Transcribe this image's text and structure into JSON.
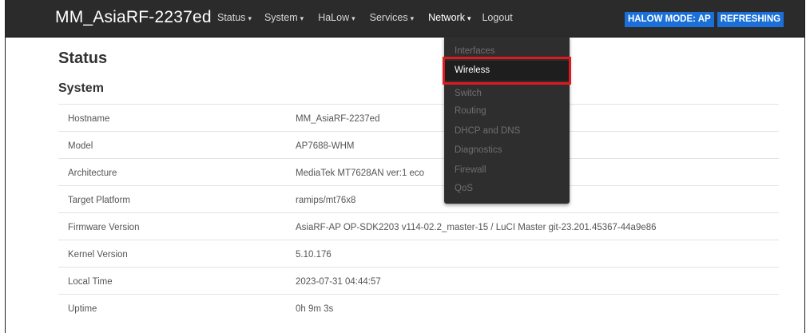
{
  "navbar": {
    "brand": "MM_AsiaRF-2237ed",
    "menu": [
      {
        "label": "Status"
      },
      {
        "label": "System"
      },
      {
        "label": "HaLow"
      },
      {
        "label": "Services"
      },
      {
        "label": "Network"
      },
      {
        "label": "Logout"
      }
    ],
    "caret": "▾",
    "badges": [
      "HALOW MODE: AP",
      "REFRESHING"
    ],
    "badge_color": "#1a6fd8"
  },
  "page": {
    "title": "Status",
    "section": "System"
  },
  "system_table": [
    {
      "label": "Hostname",
      "value": "MM_AsiaRF-2237ed"
    },
    {
      "label": "Model",
      "value": "AP7688-WHM"
    },
    {
      "label": "Architecture",
      "value": "MediaTek MT7628AN ver:1 eco"
    },
    {
      "label": "Target Platform",
      "value": "ramips/mt76x8"
    },
    {
      "label": "Firmware Version",
      "value": "AsiaRF-AP OP-SDK2203 v114-02.2_master-15 / LuCI Master git-23.201.45367-44a9e86"
    },
    {
      "label": "Kernel Version",
      "value": "5.10.176"
    },
    {
      "label": "Local Time",
      "value": "2023-07-31 04:44:57"
    },
    {
      "label": "Uptime",
      "value": "0h 9m 3s"
    }
  ],
  "network_dropdown": {
    "items": [
      "Interfaces",
      "Wireless",
      "Switch",
      "Routing",
      "DHCP and DNS",
      "Diagnostics",
      "Firewall",
      "QoS"
    ],
    "selected": "Wireless",
    "highlight_color": "#e0191f"
  }
}
